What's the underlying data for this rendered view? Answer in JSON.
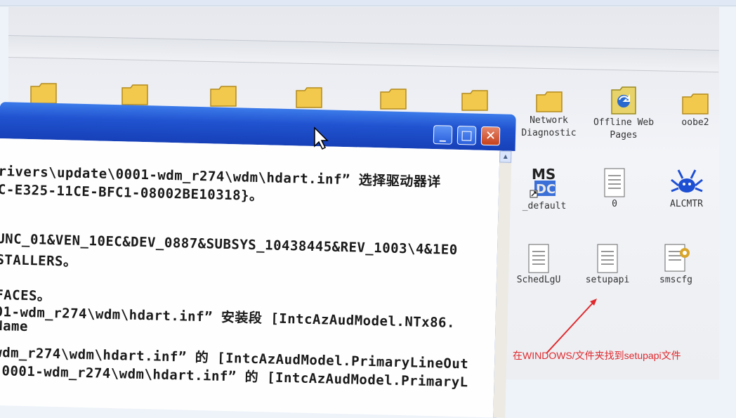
{
  "cmd": {
    "lines": [
      "rivers\\update\\0001-wdm_r274\\wdm\\hdart.inf” 选择驱动器详",
      "C-E325-11CE-BFC1-08002BE10318}。",
      "",
      "UNC_01&VEN_10EC&DEV_0887&SUBSYS_10438445&REV_1003\\4&1E0",
      "STALLERS。",
      "",
      "FACES。",
      "01-wdm_r274\\wdm\\hdart.inf” 安装段 [IntcAzAudModel.NTx86.",
      "Name",
      "",
      "wdm_r274\\wdm\\hdart.inf” 的 [IntcAzAudModel.PrimaryLineOut",
      ".0001-wdm_r274\\wdm\\hdart.inf” 的 [IntcAzAudModel.PrimaryL"
    ]
  },
  "desktop_icons": [
    {
      "label": "Network\nDiagnostic",
      "icon": "folder-icon"
    },
    {
      "label": "Offline Web\nPages",
      "icon": "web-folder-icon"
    },
    {
      "label": "oobe2",
      "icon": "folder-icon"
    },
    {
      "label": "_default",
      "icon": "ms-shortcut-icon"
    },
    {
      "label": "0",
      "icon": "text-file-icon"
    },
    {
      "label": "ALCMTR",
      "icon": "realtek-crab-icon"
    },
    {
      "label": "SchedLgU",
      "icon": "text-file-icon"
    },
    {
      "label": "setupapi",
      "icon": "text-file-icon"
    },
    {
      "label": "smscfg",
      "icon": "config-file-icon"
    }
  ],
  "annotation": {
    "text": "在WINDOWS/文件夹找到setupapi文件",
    "color": "#e0282c"
  },
  "colors": {
    "titlebar": "#2153d0",
    "folder": "#f2c94c"
  }
}
